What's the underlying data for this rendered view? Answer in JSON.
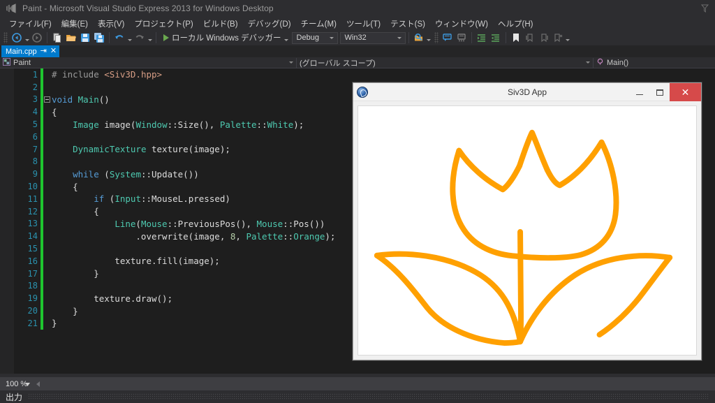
{
  "window": {
    "title": "Paint - Microsoft Visual Studio Express 2013 for Windows Desktop",
    "logo_icon": "visual-studio-logo-icon",
    "filter_icon": "filter-funnel-icon"
  },
  "menu": {
    "items": [
      {
        "label": "ファイル(F)"
      },
      {
        "label": "編集(E)"
      },
      {
        "label": "表示(V)"
      },
      {
        "label": "プロジェクト(P)"
      },
      {
        "label": "ビルド(B)"
      },
      {
        "label": "デバッグ(D)"
      },
      {
        "label": "チーム(M)"
      },
      {
        "label": "ツール(T)"
      },
      {
        "label": "テスト(S)"
      },
      {
        "label": "ウィンドウ(W)"
      },
      {
        "label": "ヘルプ(H)"
      }
    ]
  },
  "toolbar": {
    "nav_back_icon": "navigate-backward-icon",
    "nav_forward_icon": "navigate-forward-icon",
    "new_item_icon": "new-item-icon",
    "open_icon": "open-folder-icon",
    "save_icon": "save-icon",
    "save_all_icon": "save-all-icon",
    "undo_icon": "undo-icon",
    "redo_icon": "redo-icon",
    "run_label": "ローカル Windows デバッガー",
    "run_icon": "play-icon",
    "config_value": "Debug",
    "platform_value": "Win32",
    "find_icon": "find-in-files-icon",
    "comment_icon": "comment-selection-icon",
    "uncomment_icon": "uncomment-selection-icon",
    "indent_icon": "increase-indent-icon",
    "outdent_icon": "decrease-indent-icon",
    "bookmark_icon": "bookmark-icon",
    "prev_bookmark_icon": "previous-bookmark-icon",
    "next_bookmark_icon": "next-bookmark-icon",
    "clear_bookmark_icon": "clear-bookmarks-icon",
    "overflow_icon": "toolbar-overflow-icon"
  },
  "tab": {
    "label": "Main.cpp",
    "pin_icon": "pin-icon",
    "close_icon": "close-icon"
  },
  "navbar": {
    "project_icon": "project-icon",
    "project": "Paint",
    "scope": "(グローバル スコープ)",
    "member_icon": "method-icon",
    "member": "Main()"
  },
  "editor": {
    "lines": [
      {
        "n": 1,
        "mod": true,
        "fold": "none",
        "tokens": [
          {
            "t": "pp",
            "v": "# include "
          },
          {
            "t": "s",
            "v": "<Siv3D.hpp>"
          }
        ]
      },
      {
        "n": 2,
        "mod": true,
        "fold": "none",
        "tokens": []
      },
      {
        "n": 3,
        "mod": true,
        "fold": "collapse",
        "tokens": [
          {
            "t": "k",
            "v": "void"
          },
          {
            "t": "pl",
            "v": " "
          },
          {
            "t": "t",
            "v": "Main"
          },
          {
            "t": "pl",
            "v": "()"
          }
        ]
      },
      {
        "n": 4,
        "mod": true,
        "fold": "line",
        "tokens": [
          {
            "t": "pl",
            "v": "{"
          }
        ]
      },
      {
        "n": 5,
        "mod": true,
        "fold": "line",
        "tokens": [
          {
            "t": "pl",
            "v": "    "
          },
          {
            "t": "t",
            "v": "Image"
          },
          {
            "t": "pl",
            "v": " image("
          },
          {
            "t": "t",
            "v": "Window"
          },
          {
            "t": "pl",
            "v": "::Size(), "
          },
          {
            "t": "t",
            "v": "Palette"
          },
          {
            "t": "pl",
            "v": "::"
          },
          {
            "t": "t",
            "v": "White"
          },
          {
            "t": "pl",
            "v": ");"
          }
        ]
      },
      {
        "n": 6,
        "mod": true,
        "fold": "line",
        "tokens": []
      },
      {
        "n": 7,
        "mod": true,
        "fold": "line",
        "tokens": [
          {
            "t": "pl",
            "v": "    "
          },
          {
            "t": "t",
            "v": "DynamicTexture"
          },
          {
            "t": "pl",
            "v": " texture(image);"
          }
        ]
      },
      {
        "n": 8,
        "mod": true,
        "fold": "line",
        "tokens": []
      },
      {
        "n": 9,
        "mod": true,
        "fold": "line",
        "tokens": [
          {
            "t": "pl",
            "v": "    "
          },
          {
            "t": "k",
            "v": "while"
          },
          {
            "t": "pl",
            "v": " ("
          },
          {
            "t": "t",
            "v": "System"
          },
          {
            "t": "pl",
            "v": "::Update())"
          }
        ]
      },
      {
        "n": 10,
        "mod": true,
        "fold": "line",
        "tokens": [
          {
            "t": "pl",
            "v": "    {"
          }
        ]
      },
      {
        "n": 11,
        "mod": true,
        "fold": "line",
        "tokens": [
          {
            "t": "pl",
            "v": "        "
          },
          {
            "t": "k",
            "v": "if"
          },
          {
            "t": "pl",
            "v": " ("
          },
          {
            "t": "t",
            "v": "Input"
          },
          {
            "t": "pl",
            "v": "::MouseL.pressed)"
          }
        ]
      },
      {
        "n": 12,
        "mod": true,
        "fold": "line",
        "tokens": [
          {
            "t": "pl",
            "v": "        {"
          }
        ]
      },
      {
        "n": 13,
        "mod": true,
        "fold": "line",
        "tokens": [
          {
            "t": "pl",
            "v": "            "
          },
          {
            "t": "t",
            "v": "Line"
          },
          {
            "t": "pl",
            "v": "("
          },
          {
            "t": "t",
            "v": "Mouse"
          },
          {
            "t": "pl",
            "v": "::PreviousPos(), "
          },
          {
            "t": "t",
            "v": "Mouse"
          },
          {
            "t": "pl",
            "v": "::Pos())"
          }
        ]
      },
      {
        "n": 14,
        "mod": true,
        "fold": "line",
        "tokens": [
          {
            "t": "pl",
            "v": "                .overwrite(image, "
          },
          {
            "t": "num",
            "v": "8"
          },
          {
            "t": "pl",
            "v": ", "
          },
          {
            "t": "t",
            "v": "Palette"
          },
          {
            "t": "pl",
            "v": "::"
          },
          {
            "t": "t",
            "v": "Orange"
          },
          {
            "t": "pl",
            "v": ");"
          }
        ]
      },
      {
        "n": 15,
        "mod": true,
        "fold": "line",
        "tokens": []
      },
      {
        "n": 16,
        "mod": true,
        "fold": "line",
        "tokens": [
          {
            "t": "pl",
            "v": "            texture.fill(image);"
          }
        ]
      },
      {
        "n": 17,
        "mod": true,
        "fold": "line",
        "tokens": [
          {
            "t": "pl",
            "v": "        }"
          }
        ]
      },
      {
        "n": 18,
        "mod": true,
        "fold": "line",
        "tokens": []
      },
      {
        "n": 19,
        "mod": true,
        "fold": "line",
        "tokens": [
          {
            "t": "pl",
            "v": "        texture.draw();"
          }
        ]
      },
      {
        "n": 20,
        "mod": true,
        "fold": "line",
        "tokens": [
          {
            "t": "pl",
            "v": "    }"
          }
        ]
      },
      {
        "n": 21,
        "mod": true,
        "fold": "end",
        "tokens": [
          {
            "t": "pl",
            "v": "}"
          }
        ]
      }
    ]
  },
  "status": {
    "zoom": "100 %",
    "output_label": "出力"
  },
  "app_window": {
    "title": "Siv3D App",
    "icon": "siv3d-app-icon",
    "minimize_icon": "minimize-icon",
    "maximize_icon": "maximize-icon",
    "close_icon": "close-icon",
    "drawing": {
      "name": "tulip-drawing",
      "stroke_color": "#FFA000",
      "background_color": "#FFFFFF",
      "stroke_width": 8
    }
  },
  "colors": {
    "accent": "#007ACC",
    "chrome": "#2D2D30",
    "editor_bg": "#1E1E1E",
    "line_number": "#2B91AF",
    "keyword": "#569CD6",
    "type": "#4EC9B0",
    "string": "#D69D85",
    "change_bar": "#1FC52F",
    "close_button": "#D64A4A",
    "orange": "#FFA000"
  }
}
